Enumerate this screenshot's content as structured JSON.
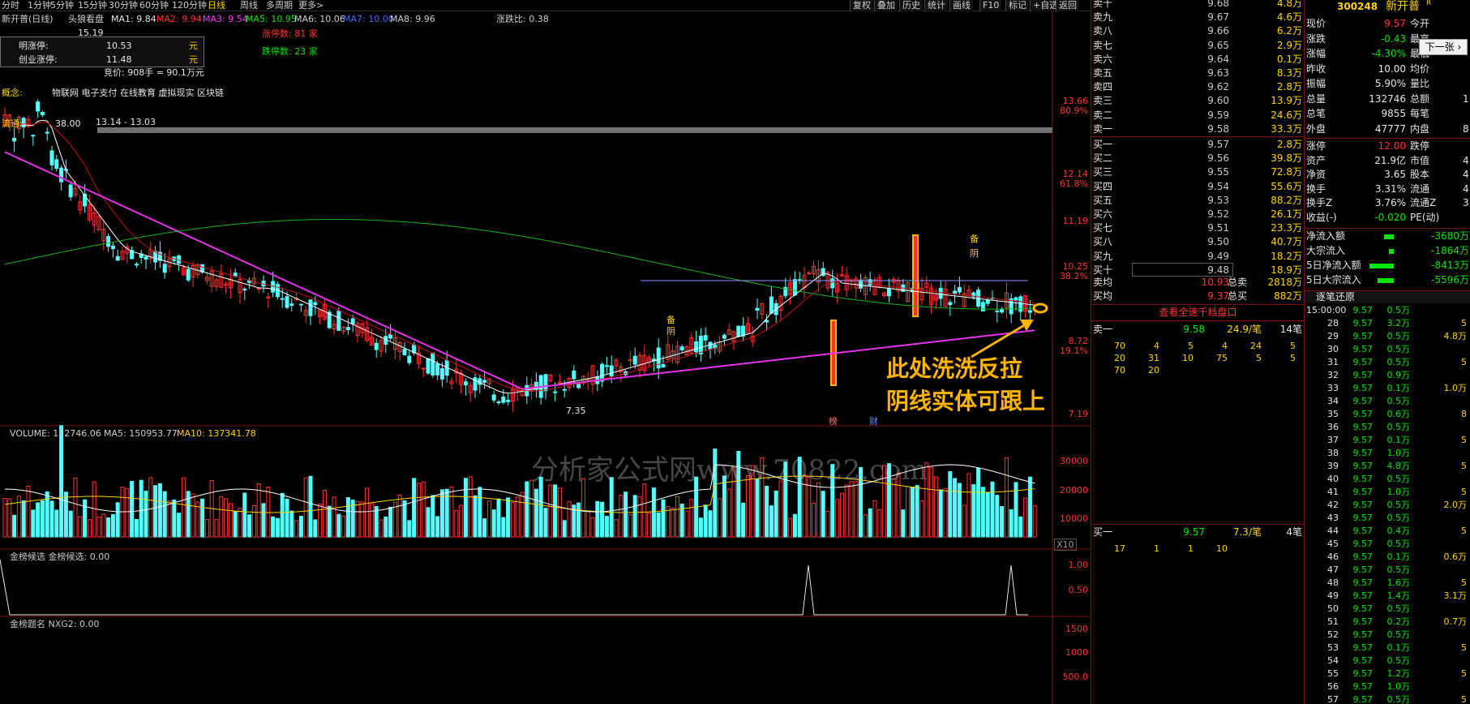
{
  "toolbar": {
    "periods": [
      "分时",
      "1分钟",
      "5分钟",
      "15分钟",
      "30分钟",
      "60分钟",
      "120分钟",
      "日线",
      "周线",
      "多周期",
      "更多>"
    ],
    "menu": [
      "复权",
      "叠加",
      "历史",
      "统计",
      "画线",
      "F10",
      "标记",
      "+自选",
      "返回"
    ]
  },
  "chart_header": {
    "title": "新开普(日线)",
    "indicator": "头狼看盘",
    "ma1": "MA1: 9.84",
    "ma2": "MA2: 9.94",
    "ma3": "MA3: 9.54",
    "ma5": "MA5: 10.95",
    "ma6": "MA6: 10.06",
    "ma7": "MA7: 10.00",
    "ma8": "MA8: 9.96",
    "ratio": "涨跌比: 0.38"
  },
  "info_box": {
    "zt_label": "明涨停:",
    "zt_val": "10.53",
    "zt_unit": "元",
    "cy_label": "创业涨停:",
    "cy_val": "11.48",
    "cy_unit": "元"
  },
  "labels": {
    "zt_count": "涨停数: 81 家",
    "dt_count": "跌停数: 23 家",
    "auction": "竞价: 908手 = 90.1万元",
    "concept_key": "概念:",
    "concept_val": "物联网 电子支付 在线教育 虚拟现实 区块链",
    "flow_key": "流通:",
    "flow_val": "38.00",
    "range_text": "13.14 - 13.03",
    "peak": "15.19",
    "low": "7.35",
    "bei1": "备",
    "yin1": "阴",
    "bei2": "备",
    "yin2": "阴",
    "bang": "榜",
    "cai": "财",
    "x10": "X10"
  },
  "price_axis": [
    {
      "v": "13.66",
      "p": "80.9%"
    },
    {
      "v": "12.14",
      "p": "61.8%"
    },
    {
      "v": "11.19",
      "p": ""
    },
    {
      "v": "10.25",
      "p": "38.2%"
    },
    {
      "v": "8.72",
      "p": "19.1%"
    },
    {
      "v": "7.19",
      "p": ""
    }
  ],
  "volume": {
    "header": "VOLUME: 132746.06",
    "ma5": "MA5: 150953.77",
    "ma10": "MA10: 137341.78",
    "axis": [
      "30000",
      "20000",
      "10000"
    ]
  },
  "jbhx": {
    "header": "金榜候选 金榜候选: 0.00",
    "axis": [
      "1.00",
      "0.50"
    ]
  },
  "jbtm": {
    "header": "金榜题名 NXG2: 0.00",
    "axis": [
      "1500",
      "1000",
      "500.0"
    ]
  },
  "annotation": {
    "line1": "此处洗洗反拉",
    "line2": "阴线实体可跟上"
  },
  "watermark": "分析家公式网www.70822.com",
  "asks": [
    [
      "卖十",
      "9.68",
      "4.8万"
    ],
    [
      "卖九",
      "9.67",
      "4.6万"
    ],
    [
      "卖八",
      "9.66",
      "6.2万"
    ],
    [
      "卖七",
      "9.65",
      "2.9万"
    ],
    [
      "卖六",
      "9.64",
      "0.1万"
    ],
    [
      "卖五",
      "9.63",
      "8.3万"
    ],
    [
      "卖四",
      "9.62",
      "2.8万"
    ],
    [
      "卖三",
      "9.60",
      "13.9万"
    ],
    [
      "卖二",
      "9.59",
      "24.6万"
    ],
    [
      "卖一",
      "9.58",
      "33.3万"
    ]
  ],
  "bids": [
    [
      "买一",
      "9.57",
      "2.8万"
    ],
    [
      "买二",
      "9.56",
      "39.8万"
    ],
    [
      "买三",
      "9.55",
      "72.8万"
    ],
    [
      "买四",
      "9.54",
      "55.6万"
    ],
    [
      "买五",
      "9.53",
      "88.2万"
    ],
    [
      "买六",
      "9.52",
      "26.1万"
    ],
    [
      "买七",
      "9.51",
      "23.3万"
    ],
    [
      "买八",
      "9.50",
      "40.7万"
    ],
    [
      "买九",
      "9.49",
      "18.2万"
    ],
    [
      "买十",
      "9.48",
      "18.9万"
    ]
  ],
  "avg": {
    "ask_label": "卖均",
    "ask_val": "10.93",
    "ask_tot_label": "总卖",
    "ask_tot": "2818万",
    "bid_label": "买均",
    "bid_val": "9.37",
    "bid_tot_label": "总买",
    "bid_tot": "882万"
  },
  "deep": {
    "link": "查看全速千档盘口",
    "ask1_label": "卖一",
    "ask1_price": "9.58",
    "ask1_avg": "24.9/笔",
    "ask1_cnt": "14笔",
    "ask1_orders": [
      [
        "70",
        "4",
        "5",
        "4",
        "24",
        "5"
      ],
      [
        "20",
        "31",
        "10",
        "75",
        "5",
        "5"
      ],
      [
        "70",
        "20"
      ]
    ],
    "bid1_label": "买一",
    "bid1_price": "9.57",
    "bid1_avg": "7.3/笔",
    "bid1_cnt": "4笔",
    "bid1_orders": [
      "17",
      "1",
      "1",
      "10"
    ]
  },
  "stock": {
    "code": "300248",
    "name": "新开普",
    "tag": "R"
  },
  "quote_rows": [
    [
      "现价",
      "9.57",
      "今开",
      ""
    ],
    [
      "涨跌",
      "-0.43",
      "最高",
      ""
    ],
    [
      "涨幅",
      "-4.30%",
      "最低",
      ""
    ],
    [
      "昨收",
      "10.00",
      "均价",
      ""
    ],
    [
      "振幅",
      "5.90%",
      "量比",
      ""
    ],
    [
      "总量",
      "132746",
      "总额",
      "1"
    ],
    [
      "总笔",
      "9855",
      "每笔",
      ""
    ],
    [
      "外盘",
      "47777",
      "内盘",
      "8"
    ]
  ],
  "quote_rows2": [
    [
      "涨停",
      "12.00",
      "跌停",
      ""
    ],
    [
      "资产",
      "21.9亿",
      "市值",
      "4"
    ],
    [
      "净资",
      "3.65",
      "股本",
      "4"
    ],
    [
      "换手",
      "3.31%",
      "流通",
      "4"
    ],
    [
      "换手Z",
      "3.76%",
      "流通Z",
      "3"
    ],
    [
      "收益(-)",
      "-0.020",
      "PE(动)",
      ""
    ]
  ],
  "flows": [
    [
      "净流入额",
      "-3680万",
      0.3
    ],
    [
      "大宗流入",
      "-1864万",
      0.15
    ],
    [
      "5日净流入额",
      "-8413万",
      0.75
    ],
    [
      "5日大宗流入",
      "-5596万",
      0.5
    ]
  ],
  "tooltip": "下一张",
  "ticks_header": "逐笔还原",
  "ticks": [
    [
      "15:00:00",
      "9.57",
      "0.5万",
      ""
    ],
    [
      "28",
      "9.57",
      "3.2万",
      "5"
    ],
    [
      "29",
      "9.57",
      "0.5万",
      "4.8万"
    ],
    [
      "30",
      "9.57",
      "0.5万",
      ""
    ],
    [
      "31",
      "9.57",
      "0.5万",
      "5"
    ],
    [
      "32",
      "9.57",
      "0.9万",
      ""
    ],
    [
      "33",
      "9.57",
      "0.1万",
      "1.0万"
    ],
    [
      "34",
      "9.57",
      "0.5万",
      ""
    ],
    [
      "35",
      "9.57",
      "0.6万",
      "8"
    ],
    [
      "36",
      "9.57",
      "0.5万",
      ""
    ],
    [
      "37",
      "9.57",
      "0.1万",
      "5"
    ],
    [
      "38",
      "9.57",
      "1.0万",
      ""
    ],
    [
      "39",
      "9.57",
      "4.8万",
      "5"
    ],
    [
      "40",
      "9.57",
      "0.5万",
      ""
    ],
    [
      "41",
      "9.57",
      "1.0万",
      "5"
    ],
    [
      "42",
      "9.57",
      "0.5万",
      "2.0万"
    ],
    [
      "43",
      "9.57",
      "0.5万",
      ""
    ],
    [
      "44",
      "9.57",
      "0.4万",
      "5"
    ],
    [
      "45",
      "9.57",
      "0.5万",
      ""
    ],
    [
      "46",
      "9.57",
      "0.1万",
      "0.6万"
    ],
    [
      "47",
      "9.57",
      "0.5万",
      ""
    ],
    [
      "48",
      "9.57",
      "1.6万",
      "5"
    ],
    [
      "49",
      "9.57",
      "1.4万",
      "3.1万"
    ],
    [
      "50",
      "9.57",
      "0.5万",
      ""
    ],
    [
      "51",
      "9.57",
      "0.2万",
      "0.7万"
    ],
    [
      "52",
      "9.57",
      "0.5万",
      ""
    ],
    [
      "53",
      "9.57",
      "0.1万",
      "5"
    ],
    [
      "54",
      "9.57",
      "0.5万",
      ""
    ],
    [
      "55",
      "9.57",
      "1.2万",
      "5"
    ],
    [
      "56",
      "9.57",
      "1.0万",
      ""
    ],
    [
      "57",
      "9.57",
      "0.5万",
      "5"
    ]
  ]
}
